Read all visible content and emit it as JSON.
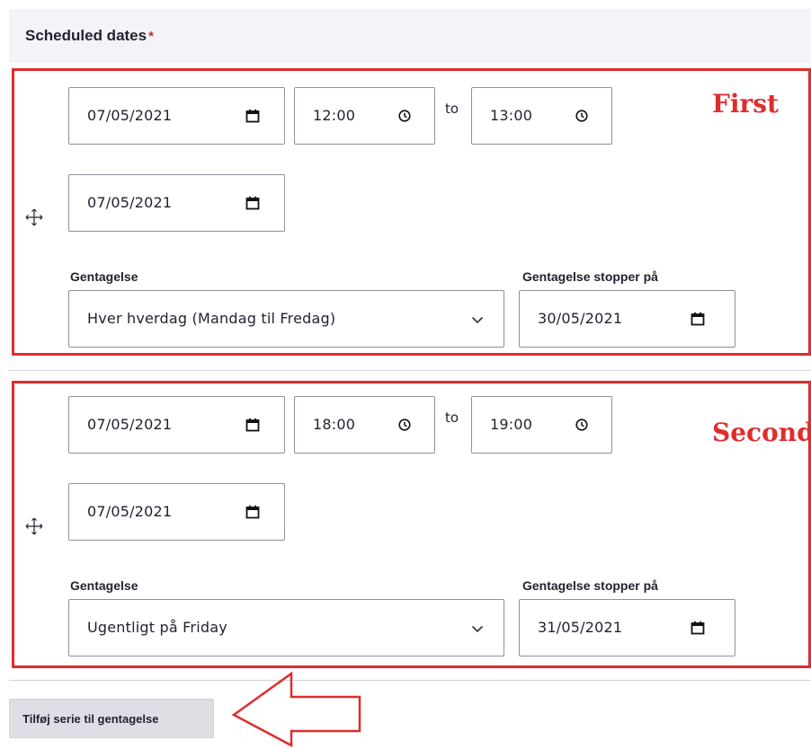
{
  "header": {
    "title": "Scheduled dates",
    "required_mark": "*"
  },
  "occurrences": [
    {
      "start_date": "07/05/2021",
      "start_time": "12:00",
      "to_label": "to",
      "end_time": "13:00",
      "end_date": "07/05/2021",
      "repeat_label": "Gentagelse",
      "repeat_value": "Hver hverdag (Mandag til Fredag)",
      "stop_label": "Gentagelse stopper på",
      "stop_date": "30/05/2021",
      "annotation": "First"
    },
    {
      "start_date": "07/05/2021",
      "start_time": "18:00",
      "to_label": "to",
      "end_time": "19:00",
      "end_date": "07/05/2021",
      "repeat_label": "Gentagelse",
      "repeat_value": "Ugentligt på Friday",
      "stop_label": "Gentagelse stopper på",
      "stop_date": "31/05/2021",
      "annotation": "Second"
    }
  ],
  "add_button": {
    "label": "Tilføj serie til gentagelse"
  },
  "colors": {
    "annotation": "#e02c2c",
    "required": "#dc2323",
    "header_bg": "#f4f4f8",
    "button_bg": "#dedfe4"
  },
  "icons": {
    "date": "calendar-icon",
    "time": "clock-icon",
    "select": "chevron-down-icon",
    "drag": "drag-handle-icon",
    "pointer": "arrow-left-icon"
  }
}
